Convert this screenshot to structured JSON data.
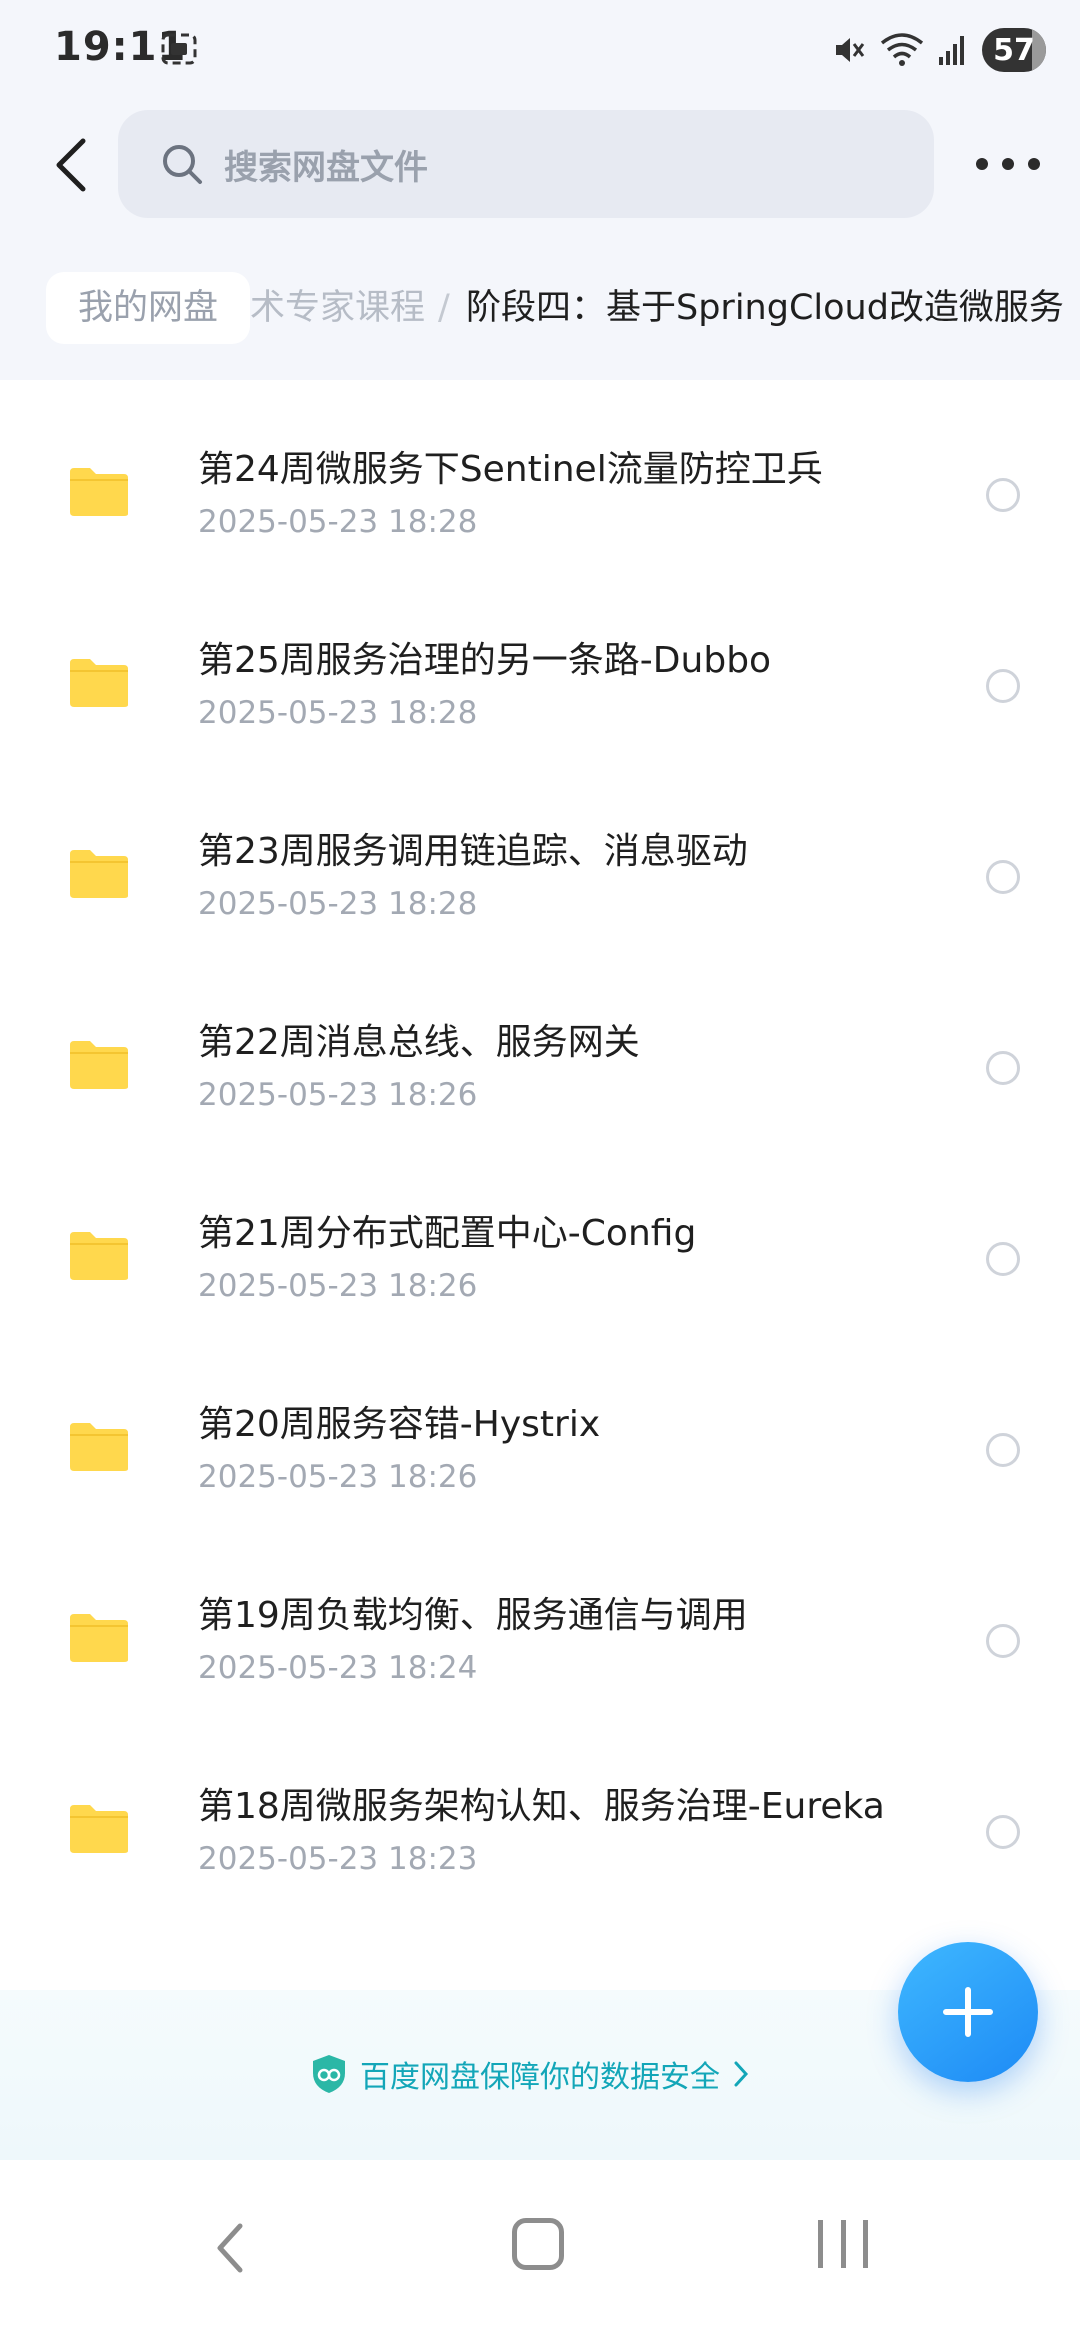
{
  "status_bar": {
    "time": "19:11",
    "battery": "57"
  },
  "search": {
    "placeholder": "搜索网盘文件"
  },
  "breadcrumb": {
    "root": "我的网盘",
    "middle": "术专家课程",
    "separator": "/",
    "current": "阶段四：基于SpringCloud改造微服务"
  },
  "files": [
    {
      "name": "第24周微服务下Sentinel流量防控卫兵",
      "date": "2025-05-23  18:28"
    },
    {
      "name": "第25周服务治理的另一条路-Dubbo",
      "date": "2025-05-23  18:28"
    },
    {
      "name": "第23周服务调用链追踪、消息驱动",
      "date": "2025-05-23  18:28"
    },
    {
      "name": "第22周消息总线、服务网关",
      "date": "2025-05-23  18:26"
    },
    {
      "name": "第21周分布式配置中心-Config",
      "date": "2025-05-23  18:26"
    },
    {
      "name": "第20周服务容错-Hystrix",
      "date": "2025-05-23  18:26"
    },
    {
      "name": "第19周负载均衡、服务通信与调用",
      "date": "2025-05-23  18:24"
    },
    {
      "name": "第18周微服务架构认知、服务治理-Eureka",
      "date": "2025-05-23  18:23"
    }
  ],
  "security_banner": {
    "text": "百度网盘保障你的数据安全"
  },
  "colors": {
    "folder": "#FFD84D",
    "accent": "#1D8AF5",
    "security": "#13A6B8"
  }
}
